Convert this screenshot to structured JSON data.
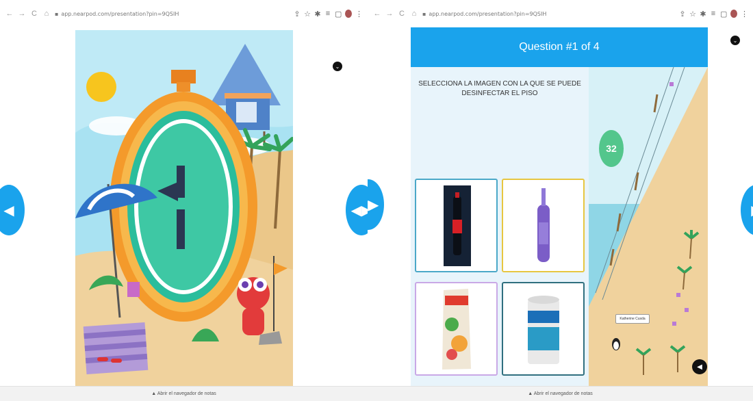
{
  "left_window": {
    "address": "app.nearpod.com/presentation?pin=9QSIH",
    "bottom_link": "▲ Abrir el navegador de notas"
  },
  "right_window": {
    "address": "app.nearpod.com/presentation?pin=9QSIH",
    "bottom_link": "▲ Abrir el navegador de notas",
    "quiz": {
      "header": "Question #1 of 4",
      "question": "SELECCIONA LA IMAGEN CON LA QUE SE PUEDE DESINFECTAR EL PISO",
      "options": [
        {
          "name": "option-coca-cola",
          "border": "#4aa8c8",
          "icon": "soda-bottle-image"
        },
        {
          "name": "option-purple-bottle",
          "border": "#e7c640",
          "icon": "purple-spray-bottle-image"
        },
        {
          "name": "option-juice-carton",
          "border": "#c9a8e6",
          "icon": "juice-carton-image"
        },
        {
          "name": "option-paint-can",
          "border": "#2f6f7f",
          "icon": "paint-can-image"
        }
      ]
    },
    "timer_value": "32",
    "player_name": "Katherine Cusda"
  },
  "colors": {
    "accent": "#1aa3ec",
    "sand": "#f0d29d",
    "sea": "#8fd6e6",
    "timer_green": "#53c68c"
  }
}
